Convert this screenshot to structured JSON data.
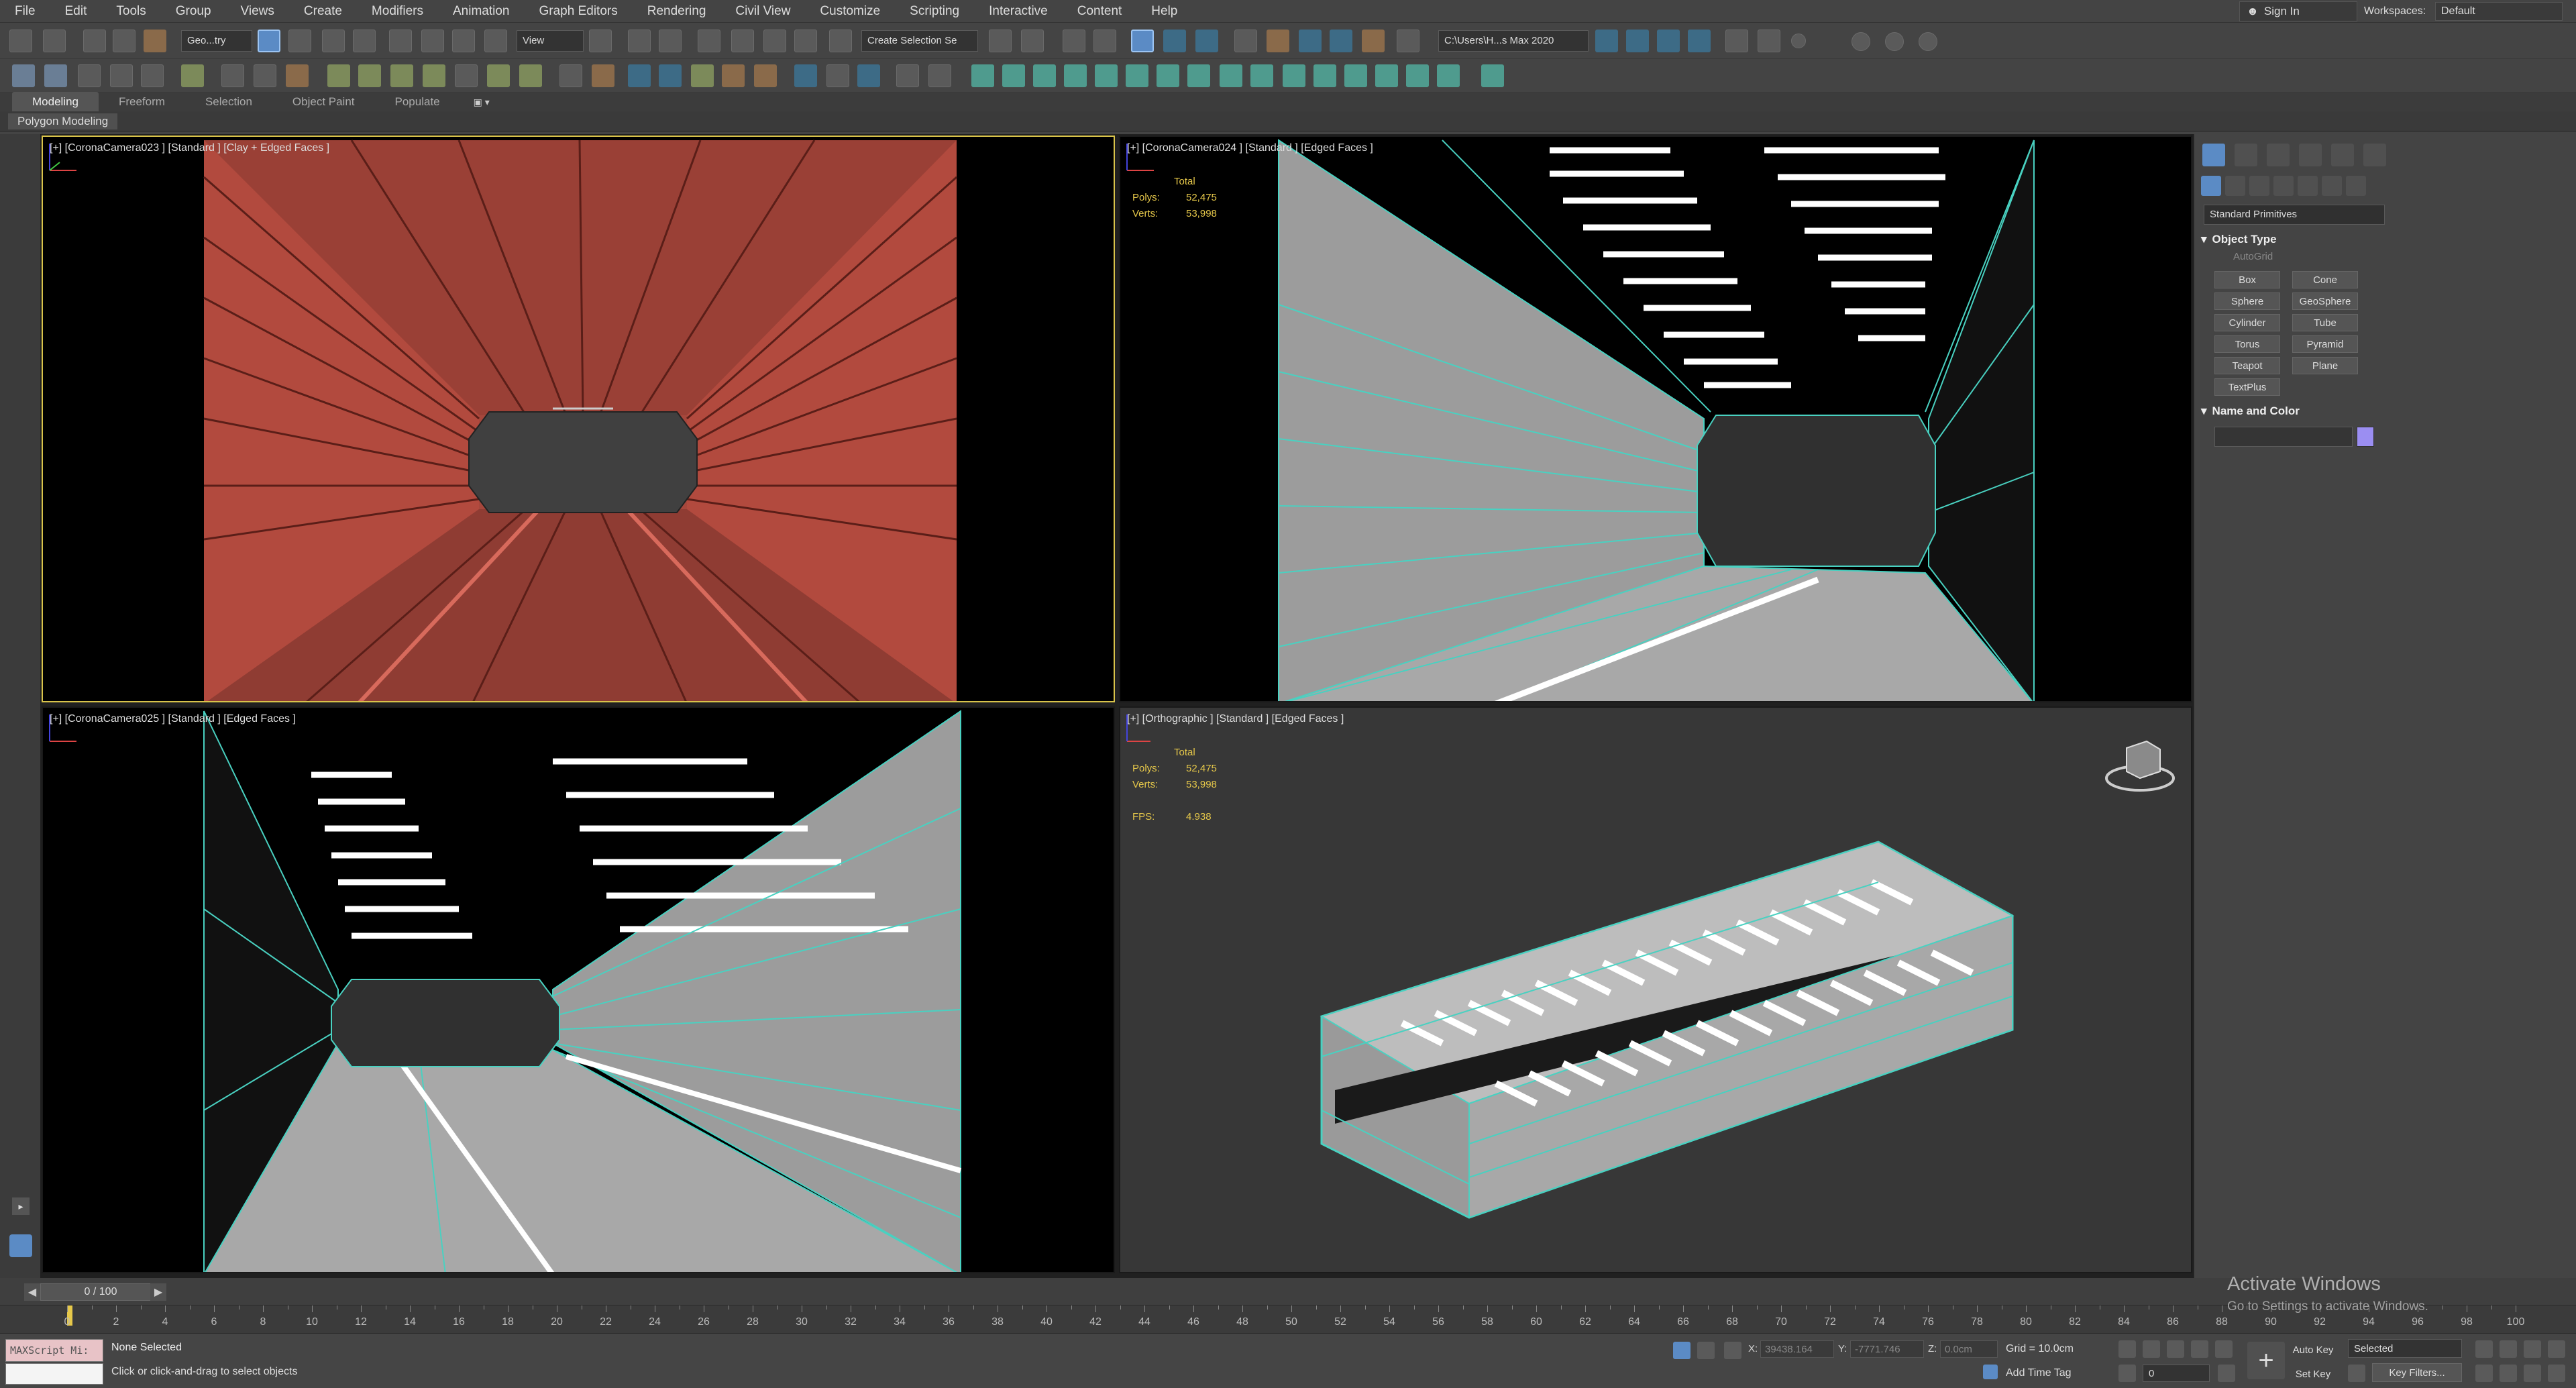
{
  "menu": [
    "File",
    "Edit",
    "Tools",
    "Group",
    "Views",
    "Create",
    "Modifiers",
    "Animation",
    "Graph Editors",
    "Rendering",
    "Civil View",
    "Customize",
    "Scripting",
    "Interactive",
    "Content",
    "Help"
  ],
  "account": {
    "signin": "Sign In",
    "workspace_label": "Workspaces:",
    "workspace_value": "Default"
  },
  "toolbar": {
    "geometry_filter": "Geo...try",
    "ref_coord": "View",
    "selection_set": "Create Selection Se",
    "path": "C:\\Users\\H...s Max 2020"
  },
  "ribbon": {
    "tabs": [
      "Modeling",
      "Freeform",
      "Selection",
      "Object Paint",
      "Populate"
    ],
    "active_tab": "Modeling",
    "sub_label": "Polygon Modeling"
  },
  "viewports": [
    {
      "label": "[+] [CoronaCamera023 ] [Standard ] [Clay + Edged Faces ]",
      "active": true
    },
    {
      "label": "[+] [CoronaCamera024 ] [Standard ] [Edged Faces ]",
      "stats": {
        "total": "Total",
        "polys_label": "Polys:",
        "polys": "52,475",
        "verts_label": "Verts:",
        "verts": "53,998"
      }
    },
    {
      "label": "[+] [CoronaCamera025 ] [Standard ] [Edged Faces ]"
    },
    {
      "label": "[+] [Orthographic ] [Standard ] [Edged Faces ]",
      "stats": {
        "total": "Total",
        "polys_label": "Polys:",
        "polys": "52,475",
        "verts_label": "Verts:",
        "verts": "53,998",
        "fps_label": "FPS:",
        "fps": "4.938"
      }
    }
  ],
  "command_panel": {
    "category": "Standard Primitives",
    "object_type_title": "Object Type",
    "autogrid": "AutoGrid",
    "buttons": [
      "Box",
      "Cone",
      "Sphere",
      "GeoSphere",
      "Cylinder",
      "Tube",
      "Torus",
      "Pyramid",
      "Teapot",
      "Plane",
      "TextPlus"
    ],
    "name_color_title": "Name and Color",
    "object_color": "#9b8ef2"
  },
  "timeline": {
    "frame": "0 / 100",
    "ticks": [
      "0",
      "2",
      "4",
      "6",
      "8",
      "10",
      "12",
      "14",
      "16",
      "18",
      "20",
      "22",
      "24",
      "26",
      "28",
      "30",
      "32",
      "34",
      "36",
      "38",
      "40",
      "42",
      "44",
      "46",
      "48",
      "50",
      "52",
      "54",
      "56",
      "58",
      "60",
      "62",
      "64",
      "66",
      "68",
      "70",
      "72",
      "74",
      "76",
      "78",
      "80",
      "82",
      "84",
      "86",
      "88",
      "90",
      "92",
      "94",
      "96",
      "98",
      "100"
    ]
  },
  "status": {
    "maxscript": "MAXScript Mi:",
    "selection": "None Selected",
    "hint": "Click or click-and-drag to select objects",
    "x_label": "X:",
    "x_value": "39438.164",
    "y_label": "Y:",
    "y_value": "-7771.746",
    "z_label": "Z:",
    "z_value": "0.0cm",
    "grid": "Grid = 10.0cm",
    "add_time_tag": "Add Time Tag",
    "auto_key": "Auto Key",
    "set_key": "Set Key",
    "key_mode": "Selected",
    "key_filters": "Key Filters...",
    "frame_value": "0"
  },
  "watermark": {
    "line1": "Activate Windows",
    "line2": "Go to Settings to activate Windows."
  },
  "colors": {
    "clay": "#b24a3e",
    "edge_cyan": "#49d1c1",
    "active_border": "#d8c34a",
    "stats_yellow": "#e6c84a"
  }
}
